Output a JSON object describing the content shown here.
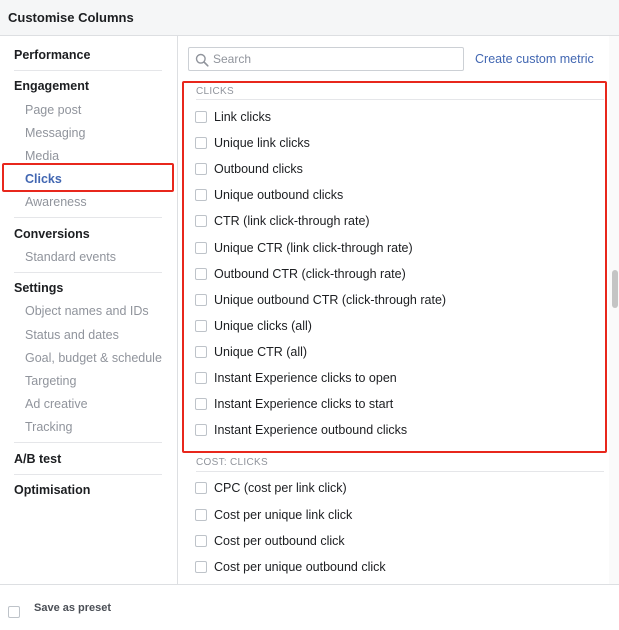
{
  "header": {
    "title": "Customise Columns"
  },
  "sidebar": {
    "sections": [
      {
        "label": "Performance",
        "items": []
      },
      {
        "label": "Engagement",
        "items": [
          "Page post",
          "Messaging",
          "Media",
          "Clicks",
          "Awareness"
        ]
      },
      {
        "label": "Conversions",
        "items": [
          "Standard events"
        ]
      },
      {
        "label": "Settings",
        "items": [
          "Object names and IDs",
          "Status and dates",
          "Goal, budget & schedule",
          "Targeting",
          "Ad creative",
          "Tracking"
        ]
      },
      {
        "label": "A/B test",
        "items": []
      },
      {
        "label": "Optimisation",
        "items": []
      }
    ],
    "active_item": "Clicks"
  },
  "search": {
    "placeholder": "Search",
    "value": ""
  },
  "custom_metric_link": "Create custom metric",
  "groups": [
    {
      "label": "CLICKS",
      "metrics": [
        "Link clicks",
        "Unique link clicks",
        "Outbound clicks",
        "Unique outbound clicks",
        "CTR (link click-through rate)",
        "Unique CTR (link click-through rate)",
        "Outbound CTR (click-through rate)",
        "Unique outbound CTR (click-through rate)",
        "Unique clicks (all)",
        "Unique CTR (all)",
        "Instant Experience clicks to open",
        "Instant Experience clicks to start",
        "Instant Experience outbound clicks"
      ]
    },
    {
      "label": "COST: CLICKS",
      "metrics": [
        "CPC (cost per link click)",
        "Cost per unique link click",
        "Cost per outbound click",
        "Cost per unique outbound click"
      ]
    }
  ],
  "footer": {
    "save_preset_label": "Save as preset"
  },
  "colors": {
    "accent": "#4267b2",
    "highlight": "#e8271c",
    "muted_text": "#90949c",
    "text": "#1c1e21"
  }
}
